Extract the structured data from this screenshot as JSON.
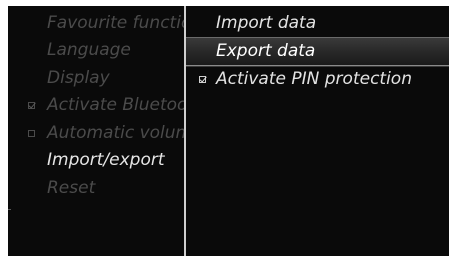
{
  "settings_menu": {
    "items": [
      {
        "label": "Favourite functions",
        "state": "dim",
        "checkbox": "none"
      },
      {
        "label": "Language",
        "state": "dim",
        "checkbox": "none"
      },
      {
        "label": "Display",
        "state": "dim",
        "checkbox": "none"
      },
      {
        "label": "Activate Bluetooth",
        "state": "dim",
        "checkbox": "checked"
      },
      {
        "label": "Automatic volume",
        "state": "dim",
        "checkbox": "unchecked"
      },
      {
        "label": "Import/export",
        "state": "active",
        "checkbox": "none"
      },
      {
        "label": "Reset",
        "state": "dim",
        "checkbox": "none"
      }
    ]
  },
  "submenu": {
    "items": [
      {
        "label": "Import data",
        "selected": false,
        "checkbox": "none"
      },
      {
        "label": "Export data",
        "selected": true,
        "checkbox": "none"
      },
      {
        "label": "Activate PIN protection",
        "selected": false,
        "checkbox": "checked"
      }
    ]
  },
  "colors": {
    "background": "#0a0a0a",
    "dim_text": "#4b4b4b",
    "active_text": "#e6e6e6",
    "highlight_bar": "#2a2a2a"
  }
}
